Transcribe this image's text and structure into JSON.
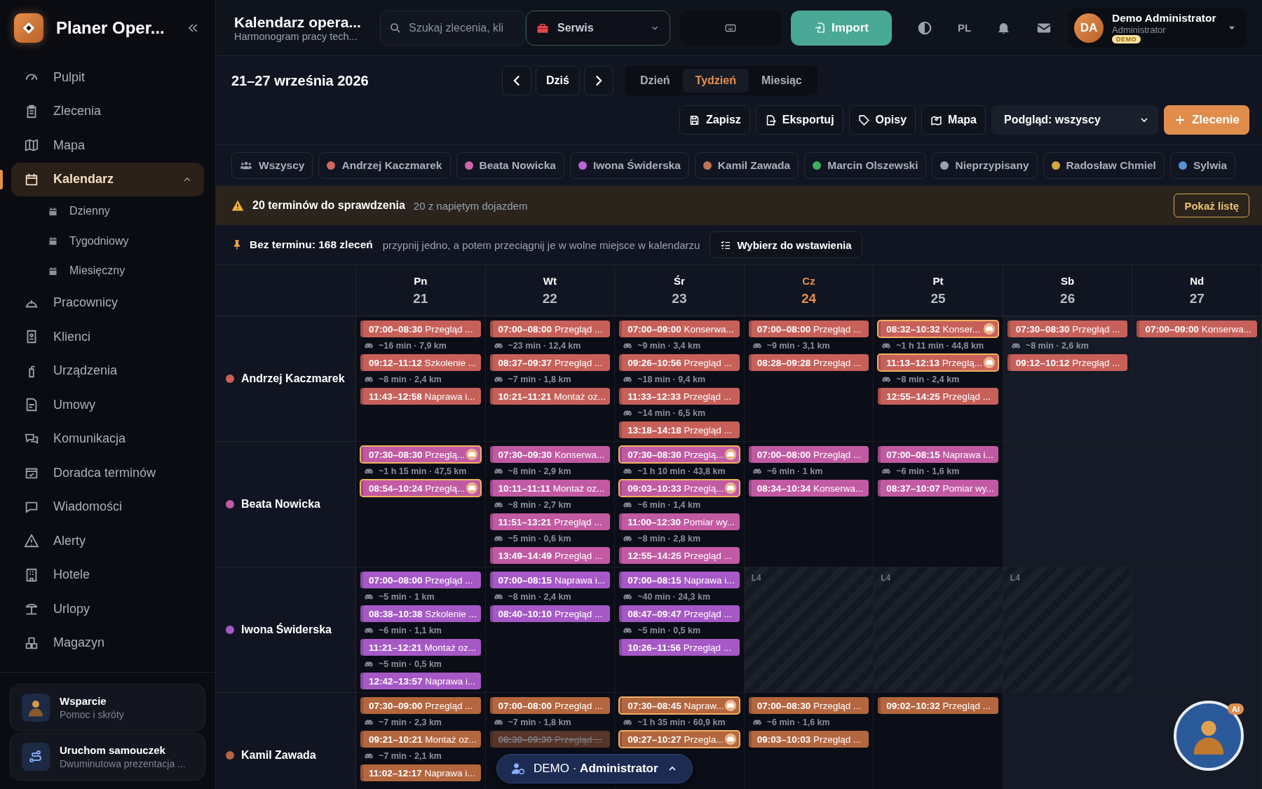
{
  "sidebar": {
    "brand": "Planer Oper...",
    "items": [
      {
        "label": "Pulpit",
        "selected": false
      },
      {
        "label": "Zlecenia",
        "selected": false
      },
      {
        "label": "Mapa",
        "selected": false
      },
      {
        "label": "Kalendarz",
        "selected": true,
        "expanded": true,
        "children": [
          {
            "label": "Dzienny",
            "selected": false
          },
          {
            "label": "Tygodniowy",
            "selected": false
          },
          {
            "label": "Miesięczny",
            "selected": false
          }
        ]
      },
      {
        "label": "Pracownicy",
        "selected": false
      },
      {
        "label": "Klienci",
        "selected": false
      },
      {
        "label": "Urządzenia",
        "selected": false
      },
      {
        "label": "Umowy",
        "selected": false
      },
      {
        "label": "Komunikacja",
        "selected": false
      },
      {
        "label": "Doradca terminów",
        "selected": false
      },
      {
        "label": "Wiadomości",
        "selected": false
      },
      {
        "label": "Alerty",
        "selected": false
      },
      {
        "label": "Hotele",
        "selected": false
      },
      {
        "label": "Urlopy",
        "selected": false
      },
      {
        "label": "Magazyn",
        "selected": false
      }
    ],
    "cards": [
      {
        "title": "Wsparcie",
        "subtitle": "Pomoc i skróty"
      },
      {
        "title": "Uruchom samouczek",
        "subtitle": "Dwuminutowa prezentacja ..."
      }
    ]
  },
  "header": {
    "title": "Kalendarz opera...",
    "subtitle": "Harmonogram pracy tech...",
    "search": {
      "placeholder": "Szukaj zlecenia, kli"
    },
    "division": {
      "value": "Serwis"
    },
    "import": "Import",
    "language": "PL",
    "user": {
      "initials": "DA",
      "name": "Demo Administrator",
      "role": "Administrator",
      "badge": "DEMO"
    }
  },
  "toolbar": {
    "range": "21–27 września 2026",
    "today": "Dziś",
    "views": [
      {
        "label": "Dzień",
        "selected": false
      },
      {
        "label": "Tydzień",
        "selected": true
      },
      {
        "label": "Miesiąc",
        "selected": false
      }
    ],
    "actions": [
      "Zapisz",
      "Eksportuj",
      "Opisy",
      "Mapa"
    ],
    "preview": {
      "value": "Podgląd: wszyscy"
    },
    "new_order": "Zlecenie"
  },
  "filters": [
    {
      "kind": "all",
      "label": "Wszyscy"
    },
    {
      "kind": "person",
      "label": "Andrzej Kaczmarek",
      "color": "#d2675f"
    },
    {
      "kind": "person",
      "label": "Beata Nowicka",
      "color": "#d166a8"
    },
    {
      "kind": "person",
      "label": "Iwona Świderska",
      "color": "#b865d6"
    },
    {
      "kind": "person",
      "label": "Kamil Zawada",
      "color": "#c07550"
    },
    {
      "kind": "person",
      "label": "Marcin Olszewski",
      "color": "#3fb15a"
    },
    {
      "kind": "person",
      "label": "Nieprzypisany",
      "color": "#9ca3af"
    },
    {
      "kind": "person",
      "label": "Radosław Chmiel",
      "color": "#d4a93a"
    },
    {
      "kind": "person",
      "label": "Sylwia",
      "color": "#5b8fd6"
    }
  ],
  "alert": {
    "title": "20 terminów do sprawdzenia",
    "detail": "20 z napiętym dojazdem",
    "button": "Pokaż listę"
  },
  "unscheduled": {
    "title": "Bez terminu: 168 zleceń",
    "hint": "przypnij jedno, a potem przeciągnij je w wolne miejsce w kalendarzu",
    "button": "Wybierz do wstawienia"
  },
  "calendar": {
    "days": [
      {
        "short": "Pn",
        "date": "21",
        "today": false,
        "weekend": false
      },
      {
        "short": "Wt",
        "date": "22",
        "today": false,
        "weekend": false
      },
      {
        "short": "Śr",
        "date": "23",
        "today": false,
        "weekend": false
      },
      {
        "short": "Cz",
        "date": "24",
        "today": true,
        "weekend": false
      },
      {
        "short": "Pt",
        "date": "25",
        "today": false,
        "weekend": false
      },
      {
        "short": "Sb",
        "date": "26",
        "today": false,
        "weekend": true
      },
      {
        "short": "Nd",
        "date": "27",
        "today": false,
        "weekend": true
      }
    ],
    "rows": [
      {
        "name": "Andrzej Kaczmarek",
        "color": "#c8605a",
        "cells": [
          {
            "items": [
              {
                "kind": "event",
                "time": "07:00–08:30",
                "title": "Przegląd ...",
                "flagged": false,
                "cancelled": false
              },
              {
                "kind": "travel",
                "text": "~16 min · 7,9 km"
              },
              {
                "kind": "event",
                "time": "09:12–11:12",
                "title": "Szkolenie ...",
                "flagged": false,
                "cancelled": false
              },
              {
                "kind": "travel",
                "text": "~8 min · 2,4 km"
              },
              {
                "kind": "event",
                "time": "11:43–12:58",
                "title": "Naprawa i...",
                "flagged": false,
                "cancelled": false
              }
            ]
          },
          {
            "items": [
              {
                "kind": "event",
                "time": "07:00–08:00",
                "title": "Przegląd ...",
                "flagged": false,
                "cancelled": false
              },
              {
                "kind": "travel",
                "text": "~23 min · 12,4 km"
              },
              {
                "kind": "event",
                "time": "08:37–09:37",
                "title": "Przegląd ...",
                "flagged": false,
                "cancelled": false
              },
              {
                "kind": "travel",
                "text": "~7 min · 1,8 km"
              },
              {
                "kind": "event",
                "time": "10:21–11:21",
                "title": "Montaż oz...",
                "flagged": false,
                "cancelled": false
              }
            ]
          },
          {
            "items": [
              {
                "kind": "event",
                "time": "07:00–09:00",
                "title": "Konserwa...",
                "flagged": false,
                "cancelled": false
              },
              {
                "kind": "travel",
                "text": "~9 min · 3,4 km"
              },
              {
                "kind": "event",
                "time": "09:26–10:56",
                "title": "Przegląd ...",
                "flagged": false,
                "cancelled": false
              },
              {
                "kind": "travel",
                "text": "~18 min · 9,4 km"
              },
              {
                "kind": "event",
                "time": "11:33–12:33",
                "title": "Przegląd ...",
                "flagged": false,
                "cancelled": false
              },
              {
                "kind": "travel",
                "text": "~14 min · 6,5 km"
              },
              {
                "kind": "event",
                "time": "13:18–14:18",
                "title": "Przegląd ...",
                "flagged": false,
                "cancelled": false
              }
            ]
          },
          {
            "items": [
              {
                "kind": "event",
                "time": "07:00–08:00",
                "title": "Przegląd ...",
                "flagged": false,
                "cancelled": false
              },
              {
                "kind": "travel",
                "text": "~9 min · 3,1 km"
              },
              {
                "kind": "event",
                "time": "08:28–09:28",
                "title": "Przegląd ...",
                "flagged": false,
                "cancelled": false
              }
            ]
          },
          {
            "items": [
              {
                "kind": "event",
                "time": "08:32–10:32",
                "title": "Konser...",
                "flagged": true,
                "cancelled": false
              },
              {
                "kind": "travel",
                "text": "~1 h 11 min · 44,8 km"
              },
              {
                "kind": "event",
                "time": "11:13–12:13",
                "title": "Przeglą...",
                "flagged": true,
                "cancelled": false
              },
              {
                "kind": "travel",
                "text": "~8 min · 2,4 km"
              },
              {
                "kind": "event",
                "time": "12:55–14:25",
                "title": "Przegląd ...",
                "flagged": false,
                "cancelled": false
              }
            ]
          },
          {
            "items": [
              {
                "kind": "event",
                "time": "07:30–08:30",
                "title": "Przegląd ...",
                "flagged": false,
                "cancelled": false
              },
              {
                "kind": "travel",
                "text": "~8 min · 2,6 km"
              },
              {
                "kind": "event",
                "time": "09:12–10:12",
                "title": "Przegląd ...",
                "flagged": false,
                "cancelled": false
              }
            ]
          },
          {
            "items": [
              {
                "kind": "event",
                "time": "07:00–09:00",
                "title": "Konserwa...",
                "flagged": false,
                "cancelled": false
              }
            ]
          }
        ]
      },
      {
        "name": "Beata Nowicka",
        "color": "#c25aa3",
        "cells": [
          {
            "items": [
              {
                "kind": "event",
                "time": "07:30–08:30",
                "title": "Przeglą...",
                "flagged": true,
                "cancelled": false
              },
              {
                "kind": "travel",
                "text": "~1 h 15 min · 47,5 km"
              },
              {
                "kind": "event",
                "time": "08:54–10:24",
                "title": "Przeglą...",
                "flagged": true,
                "cancelled": false
              }
            ]
          },
          {
            "items": [
              {
                "kind": "event",
                "time": "07:30–09:30",
                "title": "Konserwa...",
                "flagged": false,
                "cancelled": false
              },
              {
                "kind": "travel",
                "text": "~8 min · 2,9 km"
              },
              {
                "kind": "event",
                "time": "10:11–11:11",
                "title": "Montaż oz...",
                "flagged": false,
                "cancelled": false
              },
              {
                "kind": "travel",
                "text": "~8 min · 2,7 km"
              },
              {
                "kind": "event",
                "time": "11:51–13:21",
                "title": "Przegląd ...",
                "flagged": false,
                "cancelled": false
              },
              {
                "kind": "travel",
                "text": "~5 min · 0,6 km"
              },
              {
                "kind": "event",
                "time": "13:49–14:49",
                "title": "Przegląd ...",
                "flagged": false,
                "cancelled": false
              }
            ]
          },
          {
            "items": [
              {
                "kind": "event",
                "time": "07:30–08:30",
                "title": "Przeglą...",
                "flagged": true,
                "cancelled": false
              },
              {
                "kind": "travel",
                "text": "~1 h 10 min · 43,8 km"
              },
              {
                "kind": "event",
                "time": "09:03–10:33",
                "title": "Przeglą...",
                "flagged": true,
                "cancelled": false
              },
              {
                "kind": "travel",
                "text": "~6 min · 1,4 km"
              },
              {
                "kind": "event",
                "time": "11:00–12:30",
                "title": "Pomiar wy...",
                "flagged": false,
                "cancelled": false
              },
              {
                "kind": "travel",
                "text": "~8 min · 2,8 km"
              },
              {
                "kind": "event",
                "time": "12:55–14:25",
                "title": "Przegląd ...",
                "flagged": false,
                "cancelled": false
              }
            ]
          },
          {
            "items": [
              {
                "kind": "event",
                "time": "07:00–08:00",
                "title": "Przegląd ...",
                "flagged": false,
                "cancelled": false
              },
              {
                "kind": "travel",
                "text": "~6 min · 1 km"
              },
              {
                "kind": "event",
                "time": "08:34–10:34",
                "title": "Konserwa...",
                "flagged": false,
                "cancelled": false
              }
            ]
          },
          {
            "items": [
              {
                "kind": "event",
                "time": "07:00–08:15",
                "title": "Naprawa i...",
                "flagged": false,
                "cancelled": false
              },
              {
                "kind": "travel",
                "text": "~6 min · 1,6 km"
              },
              {
                "kind": "event",
                "time": "08:37–10:07",
                "title": "Pomiar wy...",
                "flagged": false,
                "cancelled": false
              }
            ]
          },
          {},
          {}
        ]
      },
      {
        "name": "Iwona Świderska",
        "color": "#a659c6",
        "cells": [
          {
            "items": [
              {
                "kind": "event",
                "time": "07:00–08:00",
                "title": "Przegląd ...",
                "flagged": false,
                "cancelled": false
              },
              {
                "kind": "travel",
                "text": "~5 min · 1 km"
              },
              {
                "kind": "event",
                "time": "08:38–10:38",
                "title": "Szkolenie ...",
                "flagged": false,
                "cancelled": false
              },
              {
                "kind": "travel",
                "text": "~6 min · 1,1 km"
              },
              {
                "kind": "event",
                "time": "11:21–12:21",
                "title": "Montaż oz...",
                "flagged": false,
                "cancelled": false
              },
              {
                "kind": "travel",
                "text": "~5 min · 0,5 km"
              },
              {
                "kind": "event",
                "time": "12:42–13:57",
                "title": "Naprawa i...",
                "flagged": false,
                "cancelled": false
              }
            ]
          },
          {
            "items": [
              {
                "kind": "event",
                "time": "07:00–08:15",
                "title": "Naprawa i...",
                "flagged": false,
                "cancelled": false
              },
              {
                "kind": "travel",
                "text": "~8 min · 2,4 km"
              },
              {
                "kind": "event",
                "time": "08:40–10:10",
                "title": "Przegląd ...",
                "flagged": false,
                "cancelled": false
              }
            ]
          },
          {
            "items": [
              {
                "kind": "event",
                "time": "07:00–08:15",
                "title": "Naprawa i...",
                "flagged": false,
                "cancelled": false
              },
              {
                "kind": "travel",
                "text": "~40 min · 24,3 km"
              },
              {
                "kind": "event",
                "time": "08:47–09:47",
                "title": "Przegląd ...",
                "flagged": false,
                "cancelled": false
              },
              {
                "kind": "travel",
                "text": "~5 min · 0,5 km"
              },
              {
                "kind": "event",
                "time": "10:26–11:56",
                "title": "Przegląd ...",
                "flagged": false,
                "cancelled": false
              }
            ]
          },
          {
            "absence": "L4"
          },
          {
            "absence": "L4"
          },
          {
            "absence": "L4"
          },
          {}
        ]
      },
      {
        "name": "Kamil Zawada",
        "color": "#b4663f",
        "cells": [
          {
            "items": [
              {
                "kind": "event",
                "time": "07:30–09:00",
                "title": "Przegląd ...",
                "flagged": false,
                "cancelled": false
              },
              {
                "kind": "travel",
                "text": "~7 min · 2,3 km"
              },
              {
                "kind": "event",
                "time": "09:21–10:21",
                "title": "Montaż oz...",
                "flagged": false,
                "cancelled": false
              },
              {
                "kind": "travel",
                "text": "~7 min · 2,1 km"
              },
              {
                "kind": "event",
                "time": "11:02–12:17",
                "title": "Naprawa i...",
                "flagged": false,
                "cancelled": false
              }
            ]
          },
          {
            "items": [
              {
                "kind": "event",
                "time": "07:00–08:00",
                "title": "Przegląd ...",
                "flagged": false,
                "cancelled": false
              },
              {
                "kind": "travel",
                "text": "~7 min · 1,8 km"
              },
              {
                "kind": "event",
                "time": "08:30–09:30",
                "title": "Przegląd ...",
                "flagged": false,
                "cancelled": true
              }
            ]
          },
          {
            "items": [
              {
                "kind": "event",
                "time": "07:30–08:45",
                "title": "Napraw...",
                "flagged": true,
                "cancelled": false
              },
              {
                "kind": "travel",
                "text": "~1 h 35 min · 60,9 km"
              },
              {
                "kind": "event",
                "time": "09:27–10:27",
                "title": "Przegla...",
                "flagged": true,
                "cancelled": false
              }
            ]
          },
          {
            "items": [
              {
                "kind": "event",
                "time": "07:00–08:30",
                "title": "Przegląd ...",
                "flagged": false,
                "cancelled": false
              },
              {
                "kind": "travel",
                "text": "~6 min · 1,6 km"
              },
              {
                "kind": "event",
                "time": "09:03–10:03",
                "title": "Przegląd ...",
                "flagged": false,
                "cancelled": false
              }
            ]
          },
          {
            "items": [
              {
                "kind": "event",
                "time": "09:02–10:32",
                "title": "Przegląd ...",
                "flagged": false,
                "cancelled": false
              }
            ]
          },
          {},
          {}
        ]
      }
    ]
  },
  "demo_bar": "DEMO · **Administrator**",
  "assistant": {
    "badge": "AI"
  }
}
